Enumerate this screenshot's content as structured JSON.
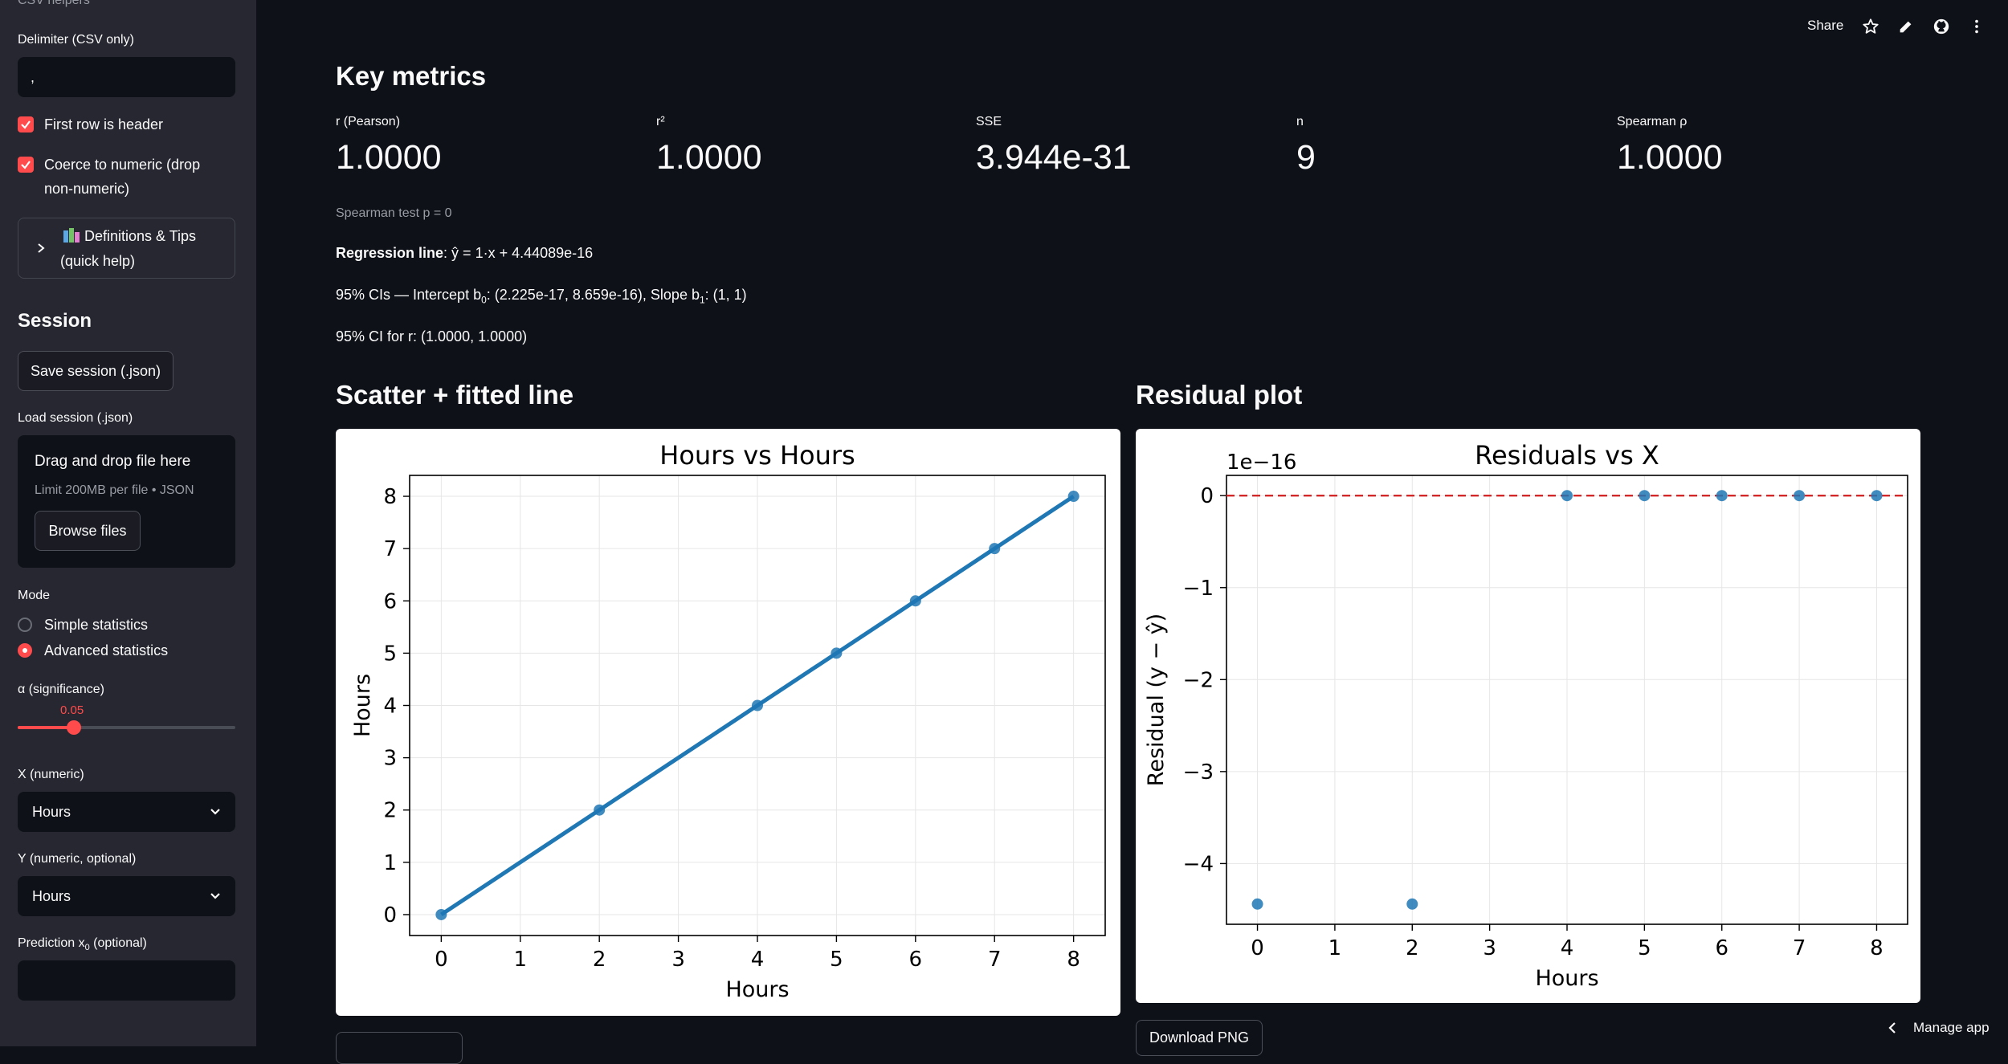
{
  "sidebar": {
    "csv_helpers_label": "CSV helpers",
    "delimiter_label": "Delimiter (CSV only)",
    "delimiter_value": ",",
    "first_row_header_label": "First row is header",
    "coerce_label_line1": "Coerce to numeric (drop",
    "coerce_label_line2": "non-numeric)",
    "definitions_line1": "Definitions & Tips",
    "definitions_line2": "(quick help)",
    "session_heading": "Session",
    "save_session_label": "Save session (.json)",
    "load_session_label": "Load session (.json)",
    "dropzone_title": "Drag and drop file here",
    "dropzone_limit": "Limit 200MB per file • JSON",
    "browse_files_label": "Browse files",
    "mode_label": "Mode",
    "mode_options": [
      "Simple statistics",
      "Advanced statistics"
    ],
    "mode_selected": "Advanced statistics",
    "alpha_label": "α (significance)",
    "alpha_value": "0.05",
    "x_label": "X (numeric)",
    "x_value": "Hours",
    "y_label": "Y (numeric, optional)",
    "y_value": "Hours",
    "prediction_label": "Prediction x",
    "prediction_sub": "0",
    "prediction_suffix": " (optional)",
    "prediction_value": ""
  },
  "topbar": {
    "share_label": "Share",
    "manage_app_label": "Manage app"
  },
  "main": {
    "key_metrics_heading": "Key metrics",
    "metrics": [
      {
        "label": "r (Pearson)",
        "value": "1.0000"
      },
      {
        "label": "r²",
        "value": "1.0000"
      },
      {
        "label": "SSE",
        "value": "3.944e-31"
      },
      {
        "label": "n",
        "value": "9"
      },
      {
        "label": "Spearman ρ",
        "value": "1.0000"
      }
    ],
    "spearman_test": "Spearman test p = 0",
    "regression_bold": "Regression line",
    "regression_rest": ": ŷ = 1·x + 4.44089e-16",
    "ci_intercept_prefix": "95% CIs — Intercept b",
    "ci_intercept_sub": "0",
    "ci_intercept_value": ": (2.225e-17, 8.659e-16), Slope b",
    "ci_slope_sub": "1",
    "ci_slope_value": ": (1, 1)",
    "ci_r": "95% CI for r: (1.0000, 1.0000)",
    "scatter_heading": "Scatter + fitted line",
    "residual_heading": "Residual plot",
    "download_png_label": "Download PNG"
  },
  "chart_data": [
    {
      "type": "scatter",
      "title": "Hours vs Hours",
      "xlabel": "Hours",
      "ylabel": "Hours",
      "x": [
        0,
        2,
        4,
        5,
        6,
        7,
        8
      ],
      "y": [
        0,
        2,
        4,
        5,
        6,
        7,
        8
      ],
      "fit_line": {
        "slope": 1,
        "intercept": 0
      },
      "xlim": [
        -0.4,
        8.4
      ],
      "ylim": [
        -0.4,
        8.4
      ],
      "xticks": [
        0,
        1,
        2,
        3,
        4,
        5,
        6,
        7,
        8
      ],
      "yticks": [
        0,
        1,
        2,
        3,
        4,
        5,
        6,
        7,
        8
      ],
      "grid": true,
      "point_color": "#1f77b4"
    },
    {
      "type": "scatter",
      "title": "Residuals vs X",
      "xlabel": "Hours",
      "ylabel": "Residual (y − ŷ)",
      "scale_label": "1e−16",
      "x": [
        0,
        2,
        4,
        5,
        6,
        7,
        8
      ],
      "y": [
        -4.44,
        -4.44,
        0,
        0,
        0,
        0,
        0
      ],
      "reference_line": {
        "y": 0,
        "color": "#d62728",
        "style": "dashed"
      },
      "xlim": [
        -0.4,
        8.4
      ],
      "ylim": [
        -4.66,
        0.22
      ],
      "xticks": [
        0,
        1,
        2,
        3,
        4,
        5,
        6,
        7,
        8
      ],
      "yticks": [
        0,
        -1,
        -2,
        -3,
        -4
      ],
      "grid": true,
      "point_color": "#1f77b4"
    }
  ],
  "colors": {
    "accent": "#ff4b4b",
    "background": "#0e1117",
    "sidebar": "#262730"
  }
}
